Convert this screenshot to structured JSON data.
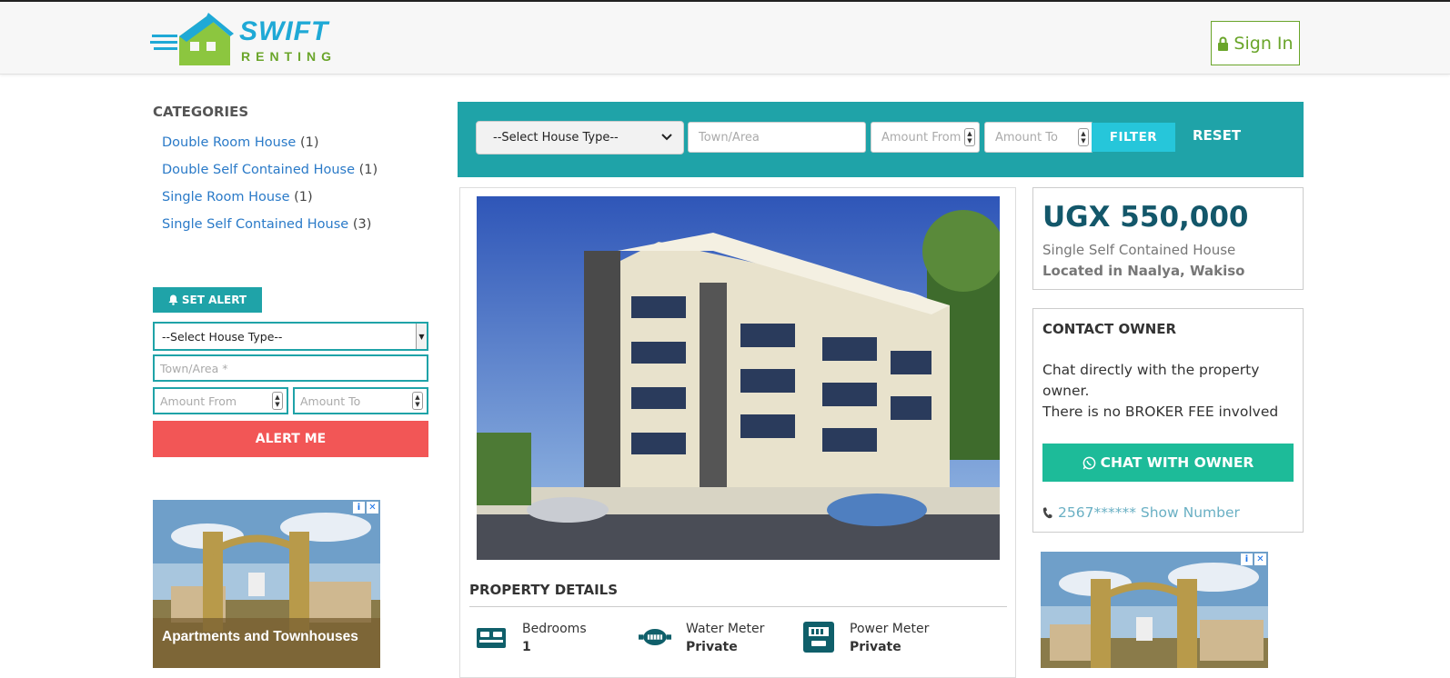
{
  "brand": {
    "name": "SWIFT",
    "sub": "RENTING",
    "accent": "#1fa9d6",
    "green": "#6aa52a"
  },
  "nav": {
    "signin_label": "Sign In"
  },
  "sidebar": {
    "categories_title": "CATEGORIES",
    "categories": [
      {
        "label": "Double Room House",
        "count": "(1)"
      },
      {
        "label": "Double Self Contained House",
        "count": "(1)"
      },
      {
        "label": "Single Room House",
        "count": "(1)"
      },
      {
        "label": "Single Self Contained House",
        "count": "(3)"
      }
    ],
    "alert": {
      "set_alert_label": "SET ALERT",
      "house_type_value": "--Select House Type--",
      "town_placeholder": "Town/Area *",
      "amount_from_placeholder": "Amount From",
      "amount_to_placeholder": "Amount To",
      "alert_button": "ALERT ME"
    },
    "ad": {
      "caption": "Apartments and Townhouses",
      "ad_info": "i",
      "ad_close": "✕"
    }
  },
  "filter": {
    "house_type_value": "--Select House Type--",
    "town_placeholder": "Town/Area",
    "amount_from_placeholder": "Amount From",
    "amount_to_placeholder": "Amount To",
    "filter_label": "FILTER",
    "reset_label": "RESET",
    "bar_color": "#1fa3a8"
  },
  "listing": {
    "price": "UGX 550,000",
    "type": "Single Self Contained House",
    "location": "Located in Naalya, Wakiso",
    "details_title": "PROPERTY DETAILS",
    "features": [
      {
        "icon": "bed-icon",
        "label": "Bedrooms",
        "value": "1"
      },
      {
        "icon": "water-meter-icon",
        "label": "Water Meter",
        "value": "Private"
      },
      {
        "icon": "power-meter-icon",
        "label": "Power Meter",
        "value": "Private"
      }
    ]
  },
  "contact": {
    "title": "CONTACT OWNER",
    "line1": "Chat directly with the property owner.",
    "line2": "There is no BROKER FEE involved",
    "chat_button": "CHAT WITH OWNER",
    "phone": "2567****** Show Number",
    "button_color": "#1dbb99"
  },
  "ad_right": {
    "ad_info": "i",
    "ad_close": "✕"
  }
}
